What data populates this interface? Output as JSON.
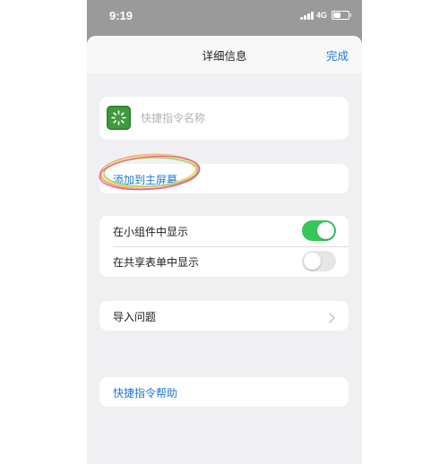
{
  "status_bar": {
    "time": "9:19",
    "network": "4G",
    "icons": [
      "signal-icon",
      "battery-icon"
    ]
  },
  "nav": {
    "title": "详细信息",
    "done_label": "完成"
  },
  "shortcut": {
    "icon": "shortcut-sparkle-icon",
    "icon_color": "#3f9a3c",
    "name_placeholder": "快捷指令名称"
  },
  "add_to_home": {
    "label": "添加到主屏幕",
    "highlight": "hand-drawn-rainbow-circle"
  },
  "settings": {
    "show_in_widget": {
      "label": "在小组件中显示",
      "enabled": true
    },
    "show_in_share_sheet": {
      "label": "在共享表单中显示",
      "enabled": false
    }
  },
  "import_questions": {
    "label": "导入问题",
    "icon": "chevron-right-icon"
  },
  "help": {
    "label": "快捷指令帮助"
  },
  "colors": {
    "accent": "#1e7ad6",
    "toggle_on": "#34c759",
    "toggle_off": "#e6e6e9",
    "background": "#f0f0f3"
  }
}
